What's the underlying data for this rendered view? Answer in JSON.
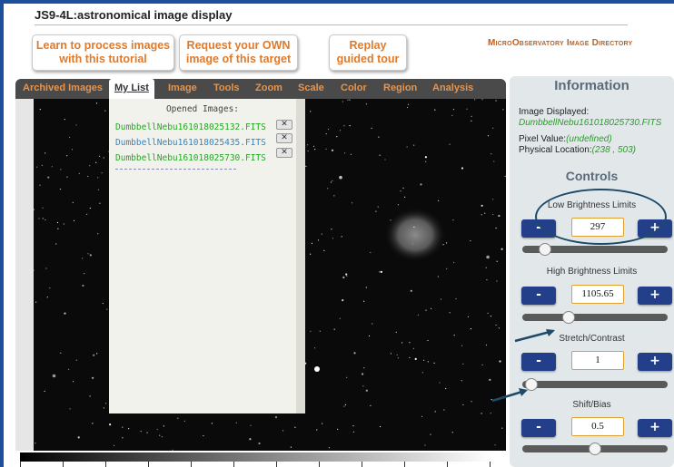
{
  "app_title": "JS9-4L:astronomical image display",
  "top_buttons": {
    "learn": [
      "Learn to process images",
      "with this tutorial"
    ],
    "request": [
      "Request your OWN",
      "image of this target"
    ],
    "replay": [
      "Replay",
      "guided tour"
    ]
  },
  "directory_link": "MicroObservatory Image Directory",
  "menu": [
    "Archived Images",
    "My List",
    "Image",
    "Tools",
    "Zoom",
    "Scale",
    "Color",
    "Region",
    "Analysis"
  ],
  "active_menu": "My List",
  "opened_images": {
    "header": "Opened Images:",
    "files": [
      {
        "name": "DumbbellNebu161018025132.FITS",
        "color": "#22a822"
      },
      {
        "name": "DumbbellNebu161018025435.FITS",
        "color": "#2f86c8"
      },
      {
        "name": "DumbbellNebu161018025730.FITS",
        "color": "#22a822"
      }
    ],
    "close_label": "✕"
  },
  "information": {
    "title": "Information",
    "image_displayed_label": "Image Displayed:",
    "image_displayed_value": "DumbbellNebu161018025730.FITS",
    "pixel_value_label": "Pixel Value:",
    "pixel_value": "(undefined)",
    "physical_location_label": "Physical Location:",
    "physical_location": "(238 , 503)"
  },
  "controls": {
    "title": "Controls",
    "minus_label": "-",
    "plus_label": "+",
    "items": [
      {
        "label": "Low Brightness Limits",
        "value": "297",
        "slider_fraction": 0.12
      },
      {
        "label": "High Brightness Limits",
        "value": "1105.65",
        "slider_fraction": 0.3
      },
      {
        "label": "Stretch/Contrast",
        "value": "1",
        "slider_fraction": 0.02
      },
      {
        "label": "Shift/Bias",
        "value": "0.5",
        "slider_fraction": 0.5
      }
    ]
  },
  "colors": {
    "frame_blue": "#1c4f9c",
    "accent_orange": "#e07a2a",
    "control_blue": "#233f8a",
    "green_text": "#2a9a2a"
  }
}
